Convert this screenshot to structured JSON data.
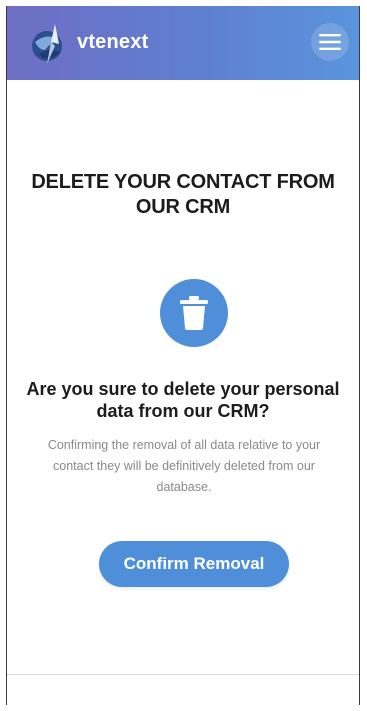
{
  "header": {
    "brand_name": "vtenext",
    "logo_icon": "globe-compass-logo",
    "menu_icon": "hamburger-menu-icon"
  },
  "main": {
    "title": "DELETE YOUR CONTACT FROM OUR CRM",
    "icon": "trash-icon",
    "question": "Are you sure to delete your personal data from our CRM?",
    "description": "Confirming the removal of all data relative to your contact they will be definitively deleted from our database.",
    "confirm_label": "Confirm Removal"
  },
  "colors": {
    "header_gradient_start": "#6e6ec4",
    "header_gradient_end": "#5a94dc",
    "accent": "#4f8fda",
    "title_text": "#1c1c1c",
    "description_text": "#8a8a8a"
  }
}
